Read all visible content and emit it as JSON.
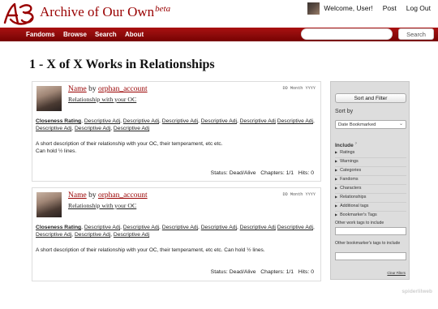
{
  "header": {
    "site_name": "Archive of Our Own",
    "site_beta": "beta",
    "greeting": "Welcome, User!",
    "post_label": "Post",
    "logout_label": "Log Out"
  },
  "nav": {
    "items": [
      "Fandoms",
      "Browse",
      "Search",
      "About"
    ],
    "search_placeholder": "",
    "search_button": "Search"
  },
  "page": {
    "heading": "1 - X of X Works in Relationships"
  },
  "works": [
    {
      "title": "Name",
      "by": "by",
      "author": "orphan_account",
      "fandom": "Relationship with your OC",
      "date": "DD Month YYYY",
      "rating": "Closeness Rating",
      "tags": [
        "Descriptive Adj",
        "Descriptive Adj",
        "Descriptive Adj",
        "Descriptive Adj",
        "Descriptive Adj",
        "Descriptive Adj",
        "Descriptive Adj",
        "Descriptive Adj",
        "Descriptive Adj"
      ],
      "summary_1": "A short description of their relationship with your OC, their temperament, etc etc.",
      "summary_2": "Can hold ½ lines.",
      "status": "Status: Dead/Alive",
      "chapters": "Chapters: 1/1",
      "hits": "Hits: 0"
    },
    {
      "title": "Name",
      "by": "by",
      "author": "orphan_account",
      "fandom": "Relationship with your OC",
      "date": "DD Month YYYY",
      "rating": "Closeness Rating",
      "tags": [
        "Descriptive Adj",
        "Descriptive Adj",
        "Descriptive Adj",
        "Descriptive Adj",
        "Descriptive Adj",
        "Descriptive Adj",
        "Descriptive Adj",
        "Descriptive Adj",
        "Descriptive Adj"
      ],
      "summary_1": "A short description of their relationship with your OC, their temperament, etc etc. Can hold ½ lines.",
      "summary_2": "",
      "status": "Status: Dead/Alive",
      "chapters": "Chapters: 1/1",
      "hits": "Hits: 0"
    }
  ],
  "sidebar": {
    "sort_filter_button": "Sort and Filter",
    "sort_by_label": "Sort by",
    "sort_by_value": "Date Bookmarked",
    "include_label": "Include",
    "include_marker": "?",
    "filters": [
      "Ratings",
      "Warnings",
      "Categories",
      "Fandoms",
      "Characters",
      "Relationships",
      "Additional tags",
      "Bookmarker's Tags"
    ],
    "other_work_tags_label": "Other work tags to include",
    "other_bookmarker_tags_label": "Other bookmarker's tags to include",
    "clear_filters": "Clear Filters"
  },
  "footer": {
    "credit": "spiderlilweb"
  },
  "colors": {
    "brand": "#990000",
    "nav_bg": "#8a0a0a"
  }
}
